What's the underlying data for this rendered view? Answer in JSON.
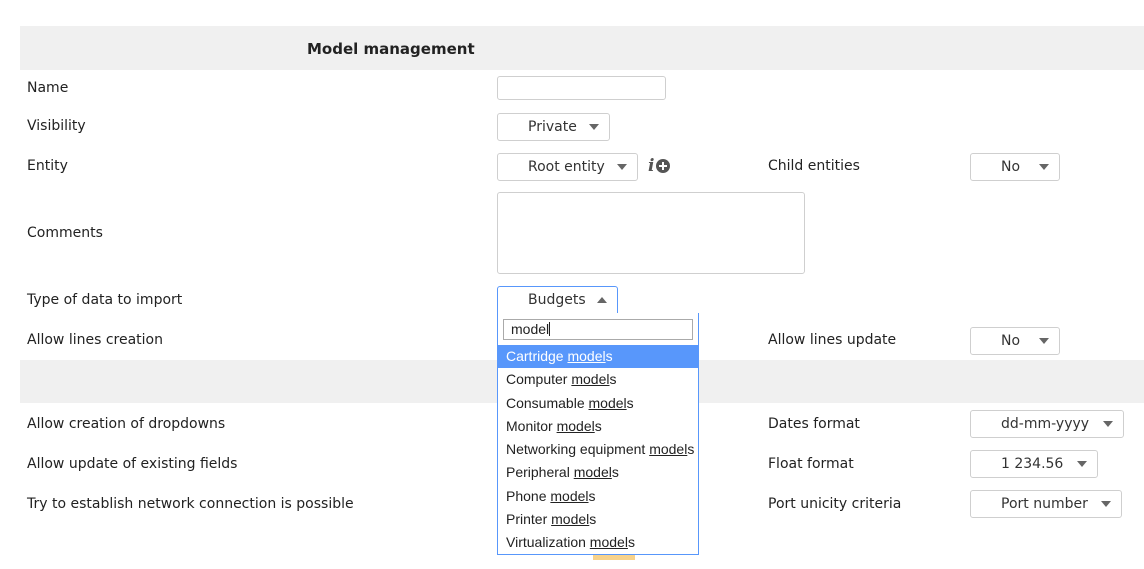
{
  "header": {
    "title": "Model management"
  },
  "form": {
    "name": {
      "label": "Name",
      "value": ""
    },
    "visibility": {
      "label": "Visibility",
      "value": "Private"
    },
    "entity": {
      "label": "Entity",
      "value": "Root entity"
    },
    "child_entities": {
      "label": "Child entities",
      "value": "No"
    },
    "comments": {
      "label": "Comments",
      "value": ""
    },
    "import_type": {
      "label": "Type of data to import",
      "value": "Budgets"
    },
    "allow_lines_creation": {
      "label": "Allow lines creation"
    },
    "allow_lines_update": {
      "label": "Allow lines update",
      "value": "No"
    },
    "allow_dropdowns": {
      "label": "Allow creation of dropdowns"
    },
    "dates_format": {
      "label": "Dates format",
      "value": "dd-mm-yyyy"
    },
    "allow_update_fields": {
      "label": "Allow update of existing fields"
    },
    "float_format": {
      "label": "Float format",
      "value": "1 234.56"
    },
    "network_connection": {
      "label": "Try to establish network connection is possible"
    },
    "port_unicity": {
      "label": "Port unicity criteria",
      "value": "Port number"
    }
  },
  "dropdown": {
    "search_value": "model",
    "match_text": "model",
    "options": [
      {
        "prefix": "Cartridge ",
        "suffix": "s",
        "highlighted": true
      },
      {
        "prefix": "Computer ",
        "suffix": "s"
      },
      {
        "prefix": "Consumable ",
        "suffix": "s"
      },
      {
        "prefix": "Monitor ",
        "suffix": "s"
      },
      {
        "prefix": "Networking equipment ",
        "suffix": "s"
      },
      {
        "prefix": "Peripheral ",
        "suffix": "s"
      },
      {
        "prefix": "Phone ",
        "suffix": "s"
      },
      {
        "prefix": "Printer ",
        "suffix": "s"
      },
      {
        "prefix": "Virtualization ",
        "suffix": "s"
      }
    ]
  },
  "icons": {
    "info": "info-icon",
    "add": "plus-circle-icon",
    "arrow": "chevron-down-icon"
  }
}
